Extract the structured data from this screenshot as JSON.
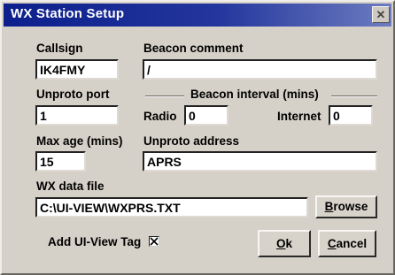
{
  "window": {
    "title": "WX Station Setup",
    "close_glyph": "✕"
  },
  "callsign": {
    "label": "Callsign",
    "value": "IK4FMY"
  },
  "beacon_comment": {
    "label": "Beacon comment",
    "value": "/"
  },
  "unproto_port": {
    "label": "Unproto port",
    "value": "1"
  },
  "beacon_interval": {
    "label": "Beacon interval (mins)",
    "radio_label": "Radio",
    "radio_value": "0",
    "internet_label": "Internet",
    "internet_value": "0"
  },
  "max_age": {
    "label": "Max age (mins)",
    "value": "15"
  },
  "unproto_address": {
    "label": "Unproto address",
    "value": "APRS"
  },
  "wx_data_file": {
    "label": "WX data file",
    "value": "C:\\UI-VIEW\\WXPRS.TXT"
  },
  "browse_button": {
    "label_first": "B",
    "label_rest": "rowse"
  },
  "add_tag": {
    "label": "Add UI-View Tag",
    "checked": true
  },
  "ok_button": {
    "label_first": "O",
    "label_rest": "k"
  },
  "cancel_button": {
    "label_first": "C",
    "label_rest": "ancel"
  }
}
